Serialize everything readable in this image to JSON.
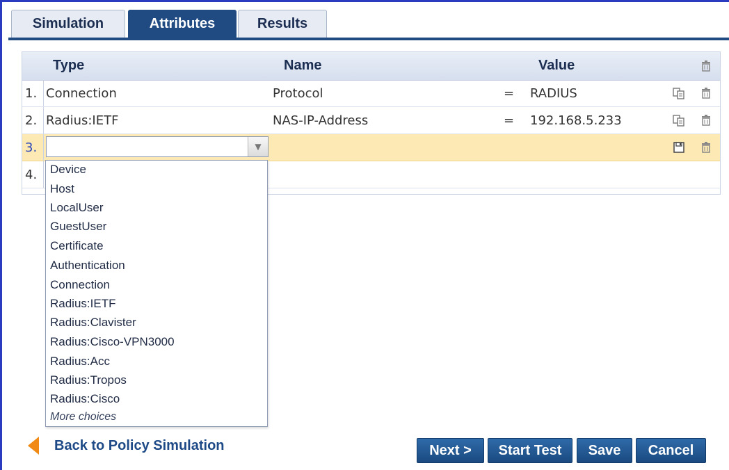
{
  "tabs": [
    {
      "label": "Simulation"
    },
    {
      "label": "Attributes",
      "active": true
    },
    {
      "label": "Results"
    }
  ],
  "table": {
    "headers": {
      "type": "Type",
      "name": "Name",
      "value": "Value"
    },
    "rows": [
      {
        "num": "1.",
        "type": "Connection",
        "name": "Protocol",
        "op": "=",
        "value": "RADIUS"
      },
      {
        "num": "2.",
        "type": "Radius:IETF",
        "name": "NAS-IP-Address",
        "op": "=",
        "value": "192.168.5.233"
      },
      {
        "num": "3.",
        "type": "",
        "name": "",
        "op": "",
        "value": ""
      },
      {
        "num": "4.",
        "type": "",
        "name": "",
        "op": "",
        "value": ""
      }
    ]
  },
  "dropdown": {
    "options": [
      "Device",
      "Host",
      "LocalUser",
      "GuestUser",
      "Certificate",
      "Authentication",
      "Connection",
      "Radius:IETF",
      "Radius:Clavister",
      "Radius:Cisco-VPN3000",
      "Radius:Acc",
      "Radius:Tropos",
      "Radius:Cisco"
    ],
    "more": "More choices"
  },
  "footer": {
    "back_label": "Back to Policy Simulation",
    "next_label": "Next >",
    "start_test_label": "Start Test",
    "save_label": "Save",
    "cancel_label": "Cancel"
  },
  "colors": {
    "tab_active": "#1f4b82",
    "edit_row": "#fce9b4",
    "back_arrow": "#f08a14",
    "button": "#1f4b82"
  },
  "icons": [
    "trash-icon",
    "copy-icon",
    "save-icon",
    "chevron-down-icon",
    "back-arrow-icon"
  ]
}
